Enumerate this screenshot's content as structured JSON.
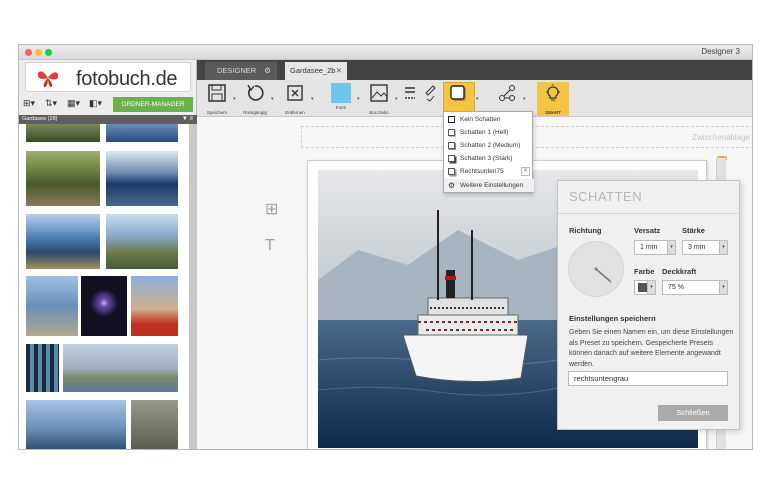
{
  "window": {
    "title": "Designer 3"
  },
  "logo": {
    "text": "fotobuch.de"
  },
  "left_toolbar": {
    "organizer_label": "ORDNER-MANAGER"
  },
  "album": {
    "header": "Gardasee (28)"
  },
  "tabs": [
    {
      "label": "DESIGNER"
    },
    {
      "label": "Gardasee_2b"
    }
  ],
  "toolbar": {
    "save": "Speichern",
    "undo": "Rückgängig",
    "remove": "Entfernen",
    "shape": "Form",
    "box_deco": "Box Deko",
    "shadow": "Schatten",
    "assign": "Zuweisen",
    "smart": "SMART"
  },
  "canvas": {
    "clipboard": "Zwischenablage"
  },
  "shadow_menu": {
    "items": [
      "Kein Schatten",
      "Schatten 1 (Hell)",
      "Schatten 2 (Medium)",
      "Schatten 3 (Stark)",
      "Rechtsunten75"
    ],
    "more": "Weitere Einstellungen"
  },
  "shadow_panel": {
    "title": "SCHATTEN",
    "direction_label": "Richtung",
    "offset_label": "Versatz",
    "offset_value": "1 mm",
    "strength_label": "Stärke",
    "strength_value": "3 mm",
    "color_label": "Farbe",
    "opacity_label": "Deckkraft",
    "opacity_value": "75 %",
    "save_heading": "Einstellungen speichern",
    "save_description": "Geben Sie einen Namen ein, um diese Einstellungen als Preset zu speichern. Gespeicherte Presets können danach auf weitere Elemente angewandt werden.",
    "preset_name": "rechtsuntengrau",
    "close_button": "Schließen"
  },
  "colors": {
    "accent_green": "#6ab04c",
    "logo_red": "#e63b3b",
    "shadow_highlight": "#f5c445",
    "smart_highlight": "#f5c445"
  }
}
